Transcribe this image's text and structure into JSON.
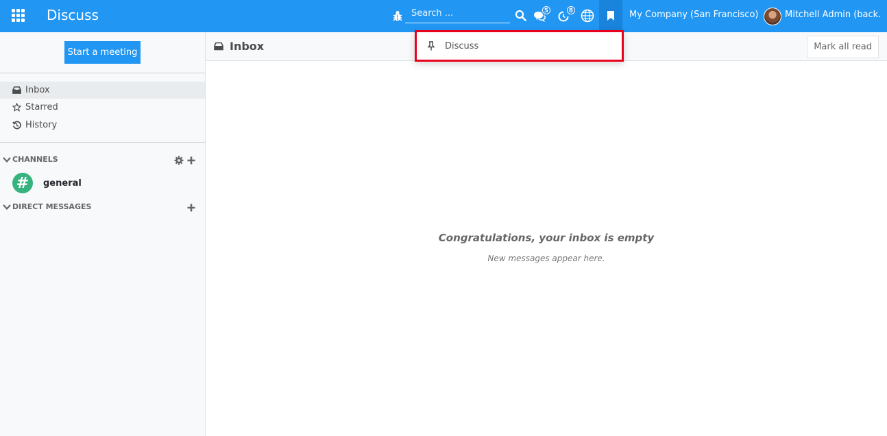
{
  "navbar": {
    "app_title": "Discuss",
    "search_placeholder": "Search ...",
    "messages_badge": "5",
    "activities_badge": "8",
    "company": "My Company (San Francisco)",
    "user": "Mitchell Admin (back..."
  },
  "dropdown": {
    "items": [
      {
        "label": "Discuss",
        "icon": "pin-icon"
      }
    ]
  },
  "sidebar": {
    "start_meeting": "Start a meeting",
    "mailboxes": [
      {
        "label": "Inbox",
        "icon": "inbox-icon"
      },
      {
        "label": "Starred",
        "icon": "star-icon"
      },
      {
        "label": "History",
        "icon": "history-icon"
      }
    ],
    "channels_header": "CHANNELS",
    "channels": [
      {
        "name": "general",
        "symbol": "#"
      }
    ],
    "direct_messages_header": "DIRECT MESSAGES"
  },
  "main": {
    "title": "Inbox",
    "mark_all_read": "Mark all read",
    "empty_title": "Congratulations, your inbox is empty",
    "empty_subtitle": "New messages appear here."
  },
  "colors": {
    "brand": "#2196f3",
    "highlight_border": "#e8001c",
    "channel_avatar": "#36b37e"
  }
}
